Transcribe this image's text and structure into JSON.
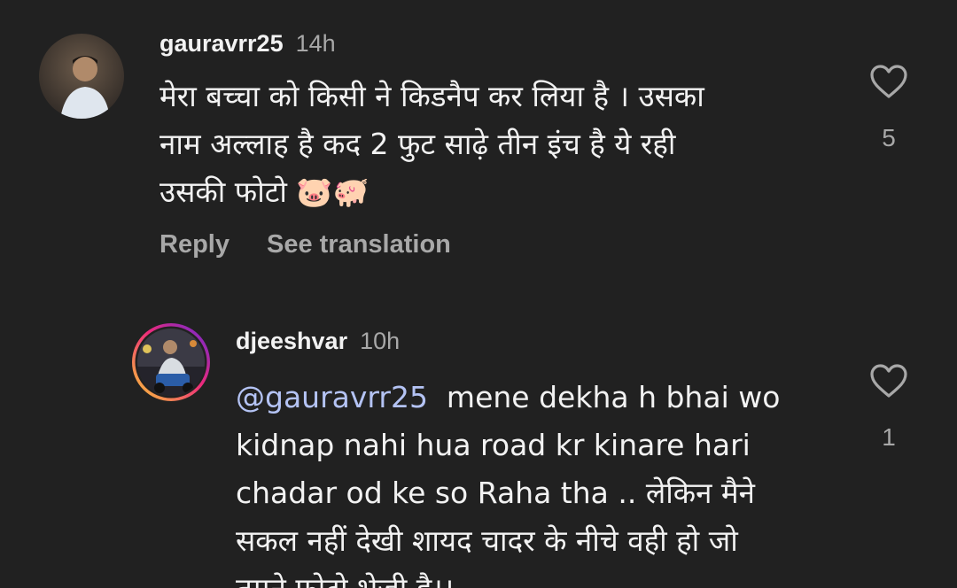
{
  "comment1": {
    "username": "gauravrr25",
    "time": "14h",
    "lines": [
      "मेरा बच्चा को किसी ने किडनैप कर लिया है । उसका",
      "नाम अल्लाह है कद 2 फुट साढ़े तीन इंच है  ये रही",
      "उसकी फोटो 🐷🐖"
    ],
    "reply_label": "Reply",
    "translate_label": "See translation",
    "like_count": "5",
    "like_icon": "heart-outline-icon"
  },
  "comment2": {
    "username": "djeeshvar",
    "time": "10h",
    "mention": "@gauravrr25",
    "first_line_rest": "  mene dekha h bhai wo",
    "lines": [
      "kidnap nahi hua road kr kinare hari",
      "chadar od ke so Raha tha .. लेकिन मैने",
      "सकल नहीं देखी शायद चादर के नीचे वही हो जो",
      "तुमने फोटो भेजी है।।"
    ],
    "like_count": "1",
    "like_icon": "heart-outline-icon",
    "avatar_ring_colors": [
      "#f9ce34",
      "#ee2a7b",
      "#6228d7"
    ]
  },
  "colors": {
    "background": "#212121",
    "primary_text": "#f2f2f2",
    "secondary_text": "#a8a8a8",
    "mention": "#b4c3f4"
  }
}
